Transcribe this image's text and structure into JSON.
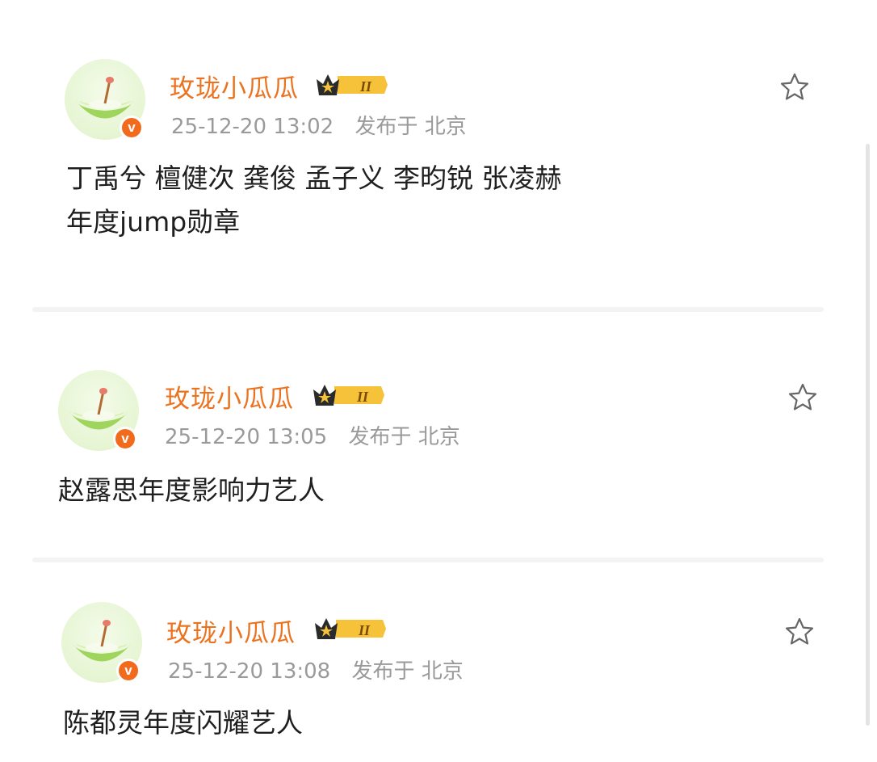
{
  "posts": [
    {
      "username": "玫珑小瓜瓜",
      "level": "II",
      "date": "25-12-20 13:02",
      "published_label": "发布于",
      "location": "北京",
      "content_lines": [
        "丁禹兮 檀健次 龚俊  孟子义 李昀锐 张凌赫",
        "年度jump勋章"
      ]
    },
    {
      "username": "玫珑小瓜瓜",
      "level": "II",
      "date": "25-12-20 13:05",
      "published_label": "发布于",
      "location": "北京",
      "content_lines": [
        "赵露思年度影响力艺人"
      ]
    },
    {
      "username": "玫珑小瓜瓜",
      "level": "II",
      "date": "25-12-20 13:08",
      "published_label": "发布于",
      "location": "北京",
      "content_lines": [
        "陈都灵年度闪耀艺人"
      ]
    }
  ],
  "icons": {
    "verified": "v",
    "favorite": "star-outline-icon",
    "crown": "crown-icon"
  },
  "colors": {
    "username": "#eb7320",
    "meta": "#9a9a9a",
    "verified_badge": "#f26b1d",
    "content": "#1f1f1f"
  }
}
